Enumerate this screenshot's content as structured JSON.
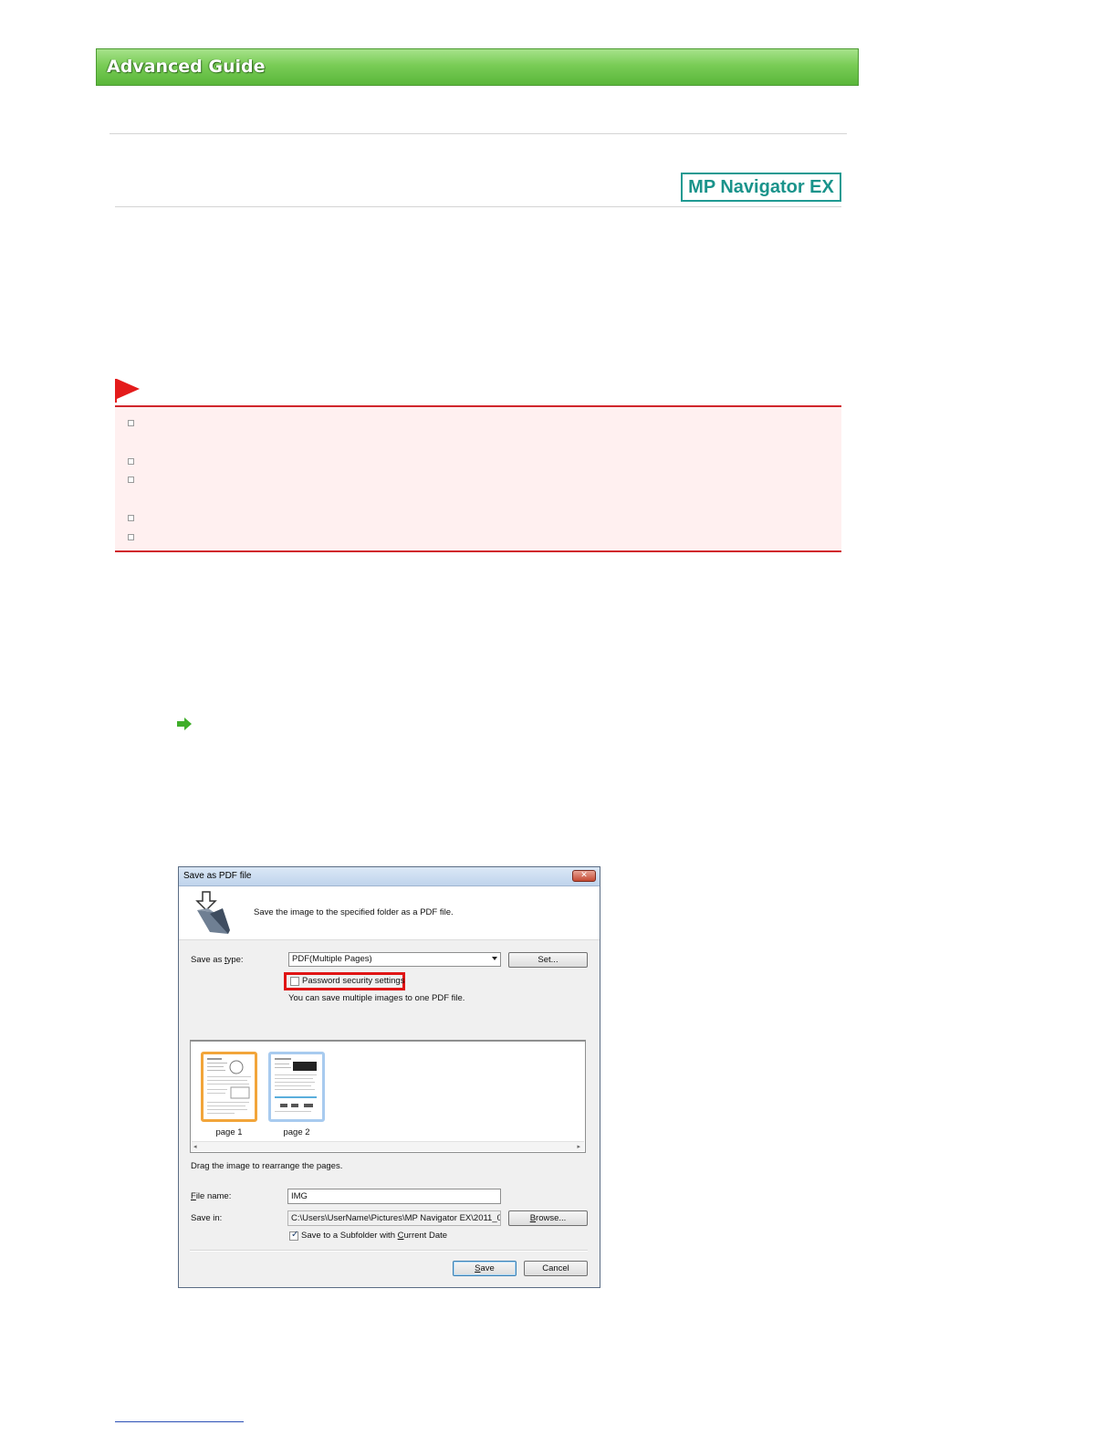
{
  "banner": {
    "title": "Advanced Guide"
  },
  "product_badge": "MP Navigator EX",
  "colors": {
    "banner_green": "#79cc56",
    "badge_teal": "#1a938b",
    "important_red": "#d0262c",
    "important_bg": "#fff0f0",
    "highlight_red": "#e01515",
    "link_blue": "#2b4fb5"
  },
  "icons": {
    "flag": "red-flag-icon",
    "arrow": "green-arrow-icon"
  },
  "important_bullets": 5,
  "dialog": {
    "title": "Save as PDF file",
    "close_label": "✕",
    "header_text": "Save the image to the specified folder as a PDF file.",
    "save_as_type_label": "Save as type:",
    "save_as_type_value": "PDF(Multiple Pages)",
    "set_button": "Set...",
    "password_checkbox_label": "Password security settings",
    "password_checked": false,
    "info_text": "You can save multiple images to one PDF file.",
    "pages": [
      {
        "label": "page 1",
        "selected": true
      },
      {
        "label": "page 2",
        "selected": false
      }
    ],
    "drag_hint": "Drag the image to rearrange the pages.",
    "file_name_label": "File name:",
    "file_name_value": "IMG",
    "save_in_label": "Save in:",
    "save_in_value": "C:\\Users\\UserName\\Pictures\\MP Navigator EX\\2011_0",
    "browse_button": "Browse...",
    "subfolder_label": "Save to a Subfolder with Current Date",
    "subfolder_checked": true,
    "save_button": "Save",
    "cancel_button": "Cancel"
  }
}
